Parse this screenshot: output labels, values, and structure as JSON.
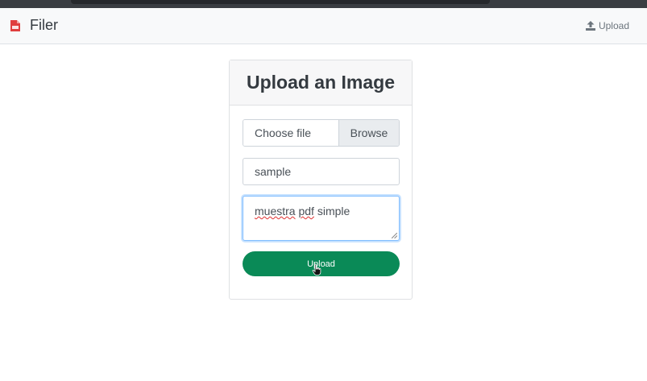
{
  "navbar": {
    "brand": "Filer",
    "brand_icon": "pdf-file-icon",
    "upload_link": "Upload",
    "upload_icon": "upload-icon"
  },
  "form": {
    "title": "Upload an Image",
    "file": {
      "label": "Choose file",
      "browse": "Browse"
    },
    "name_value": "sample",
    "description_words": [
      "muestra",
      "pdf",
      "simple"
    ],
    "submit": "Upload"
  },
  "colors": {
    "accent": "#0a8a57",
    "brand_icon": "#e03e3e",
    "focus_border": "#80bdff"
  }
}
